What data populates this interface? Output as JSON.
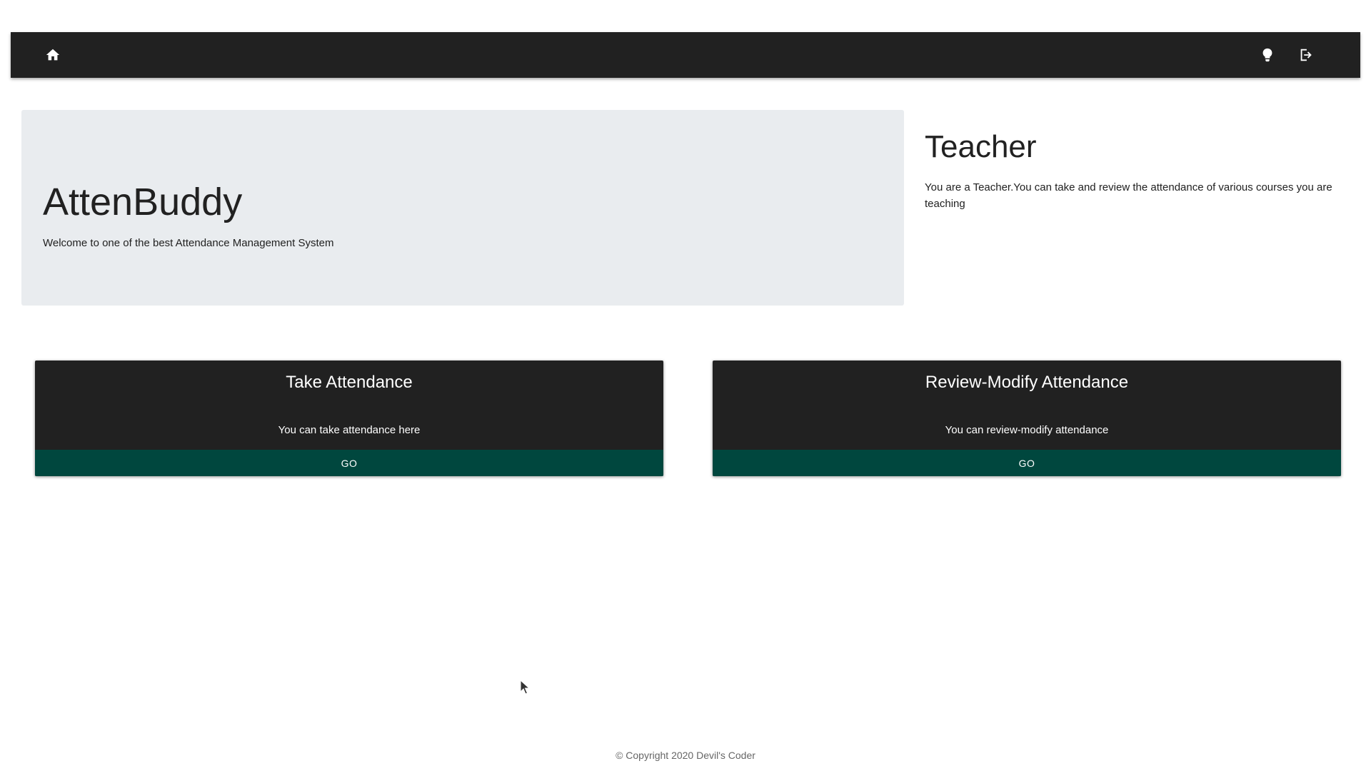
{
  "navbar": {
    "icons": {
      "home": "home-icon",
      "theme": "lightbulb-icon",
      "logout": "logout-icon"
    },
    "background": "#212121"
  },
  "hero": {
    "title": "AttenBuddy",
    "subtitle": "Welcome to one of the best Attendance Management System",
    "background": "#e9ecef"
  },
  "role": {
    "title": "Teacher",
    "description": "You are a Teacher.You can take and review the attendance of various courses you are teaching"
  },
  "cards": [
    {
      "title": "Take Attendance",
      "text": "You can take attendance here",
      "button": "GO"
    },
    {
      "title": "Review-Modify Attendance",
      "text": "You can review-modify attendance",
      "button": "GO"
    }
  ],
  "footer": {
    "copyright": "© Copyright 2020 Devil's Coder"
  },
  "colors": {
    "card_background": "#212121",
    "button_background": "#00473e"
  }
}
